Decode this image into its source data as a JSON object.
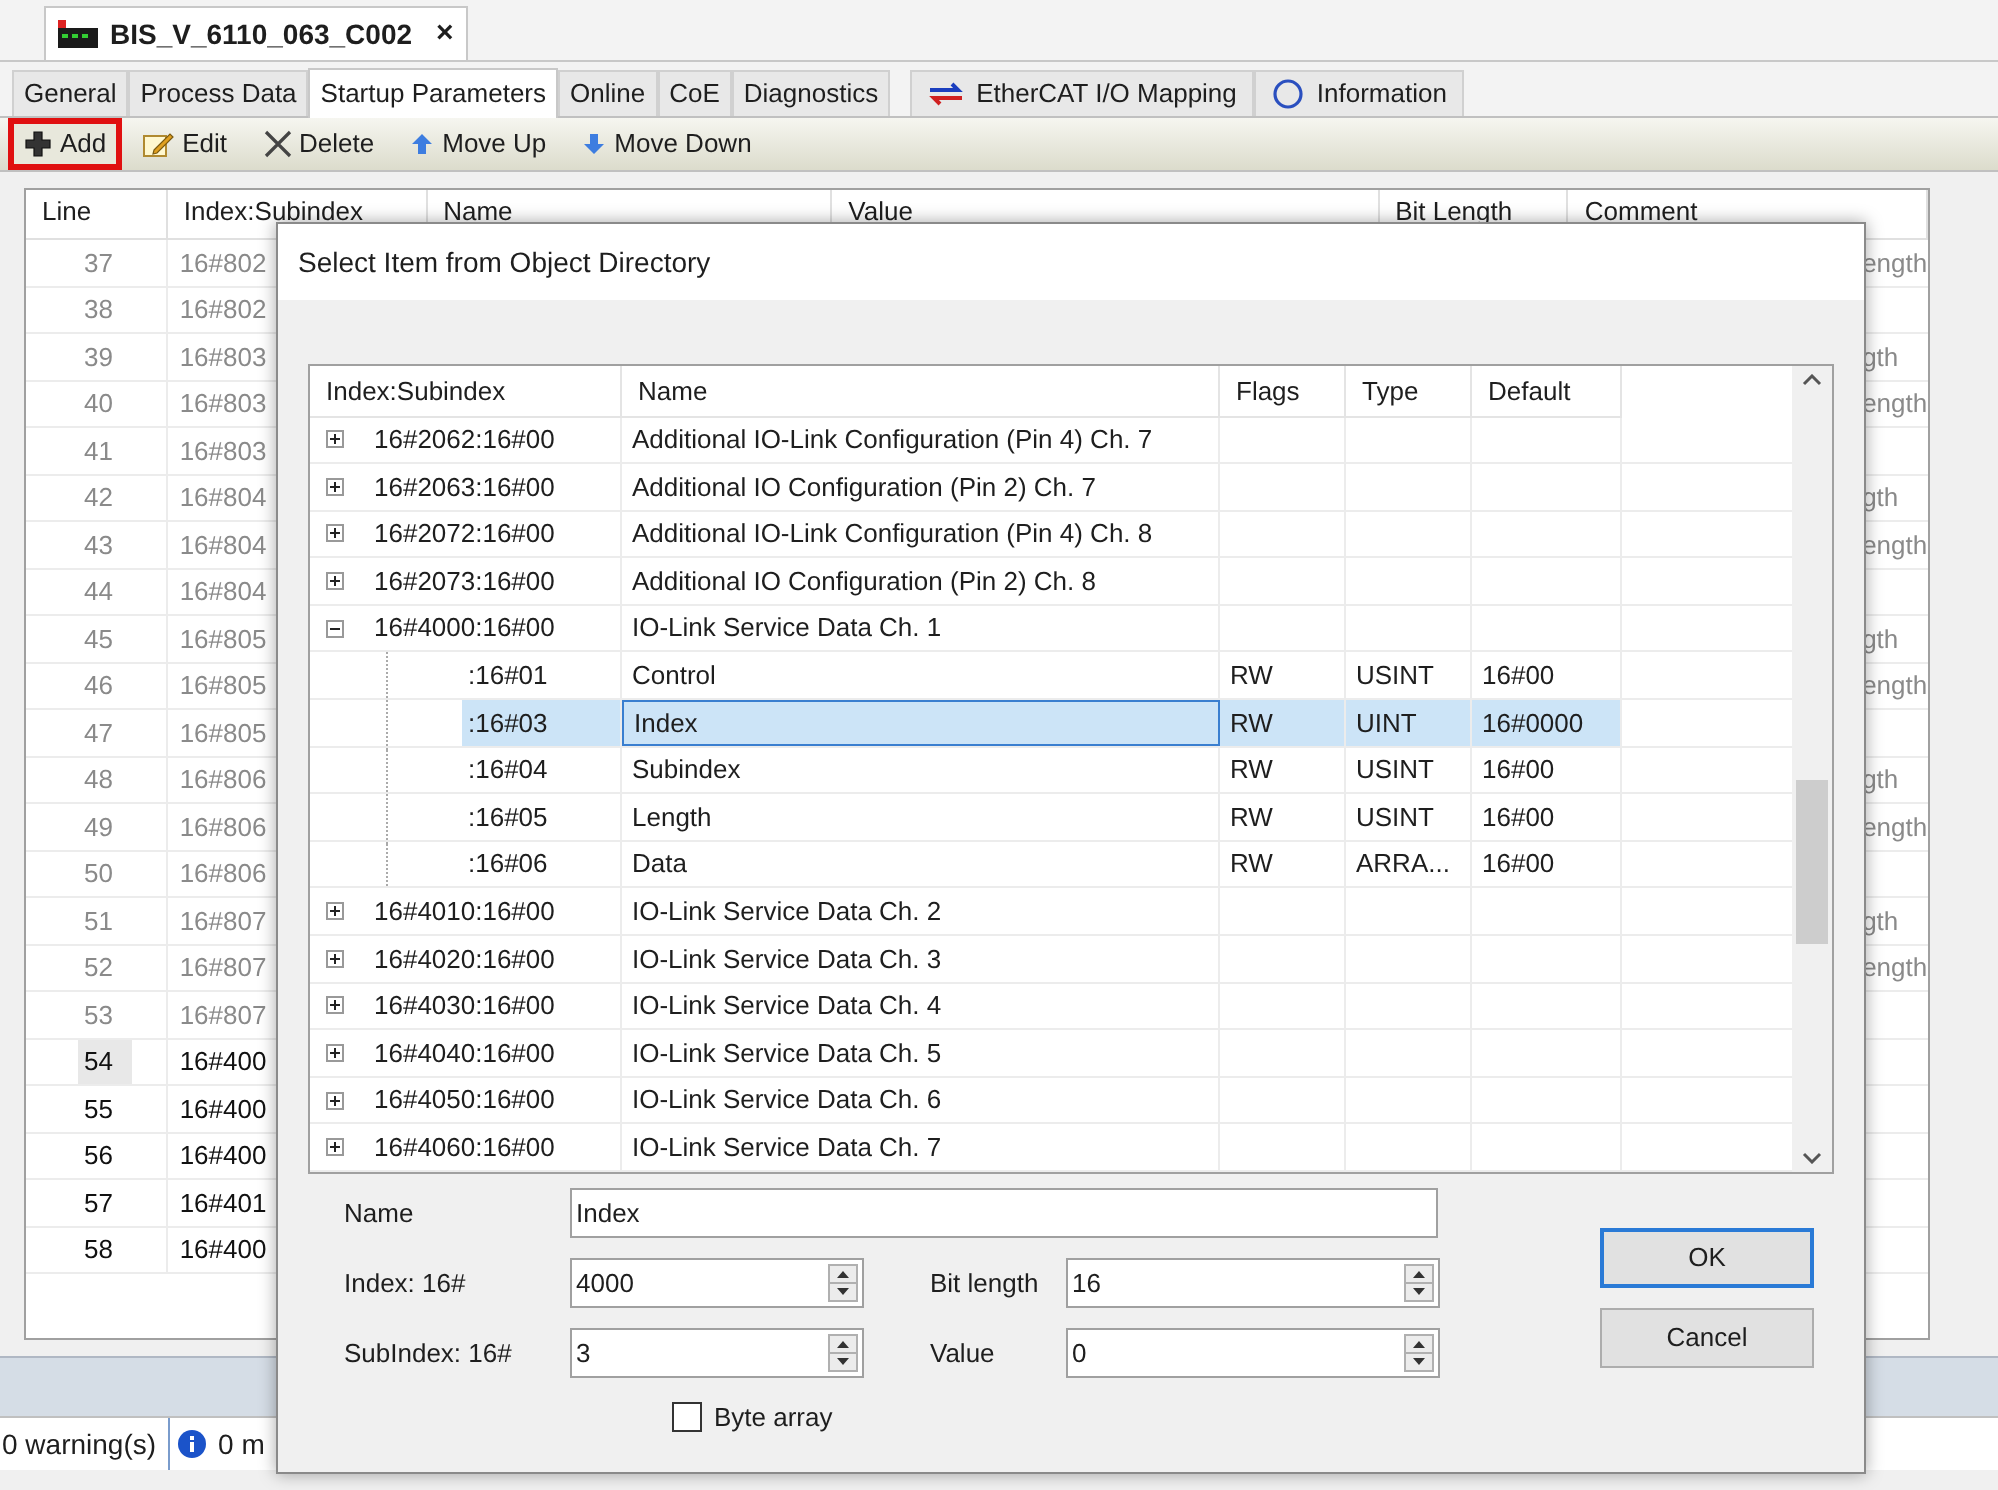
{
  "document_tab": {
    "title": "BIS_V_6110_063_C002",
    "close": "×"
  },
  "tabs": [
    {
      "label": "General",
      "selected": false
    },
    {
      "label": "Process Data",
      "selected": false
    },
    {
      "label": "Startup Parameters",
      "selected": true
    },
    {
      "label": "Online",
      "selected": false
    },
    {
      "label": "CoE",
      "selected": false
    },
    {
      "label": "Diagnostics",
      "selected": false
    },
    {
      "label": "EtherCAT I/O Mapping",
      "selected": false
    },
    {
      "label": "Information",
      "selected": false
    }
  ],
  "toolbar": [
    {
      "label": "Add",
      "highlighted": true
    },
    {
      "label": "Edit",
      "highlighted": false
    },
    {
      "label": "Delete",
      "highlighted": false
    },
    {
      "label": "Move Up",
      "highlighted": false
    },
    {
      "label": "Move Down",
      "highlighted": false
    }
  ],
  "startup_table": {
    "columns": [
      "Line",
      "Index:Subindex",
      "Name",
      "Value",
      "Bit Length",
      "Comment"
    ],
    "rows": [
      {
        "line": "37",
        "index": "16#802",
        "comment": "ength",
        "greyed": true,
        "selected": false
      },
      {
        "line": "38",
        "index": "16#802",
        "greyed": true,
        "selected": false
      },
      {
        "line": "39",
        "index": "16#803",
        "comment": "gth",
        "greyed": true,
        "selected": false
      },
      {
        "line": "40",
        "index": "16#803",
        "comment": "ength",
        "greyed": true,
        "selected": false
      },
      {
        "line": "41",
        "index": "16#803",
        "greyed": true,
        "selected": false
      },
      {
        "line": "42",
        "index": "16#804",
        "comment": "gth",
        "greyed": true,
        "selected": false
      },
      {
        "line": "43",
        "index": "16#804",
        "comment": "ength",
        "greyed": true,
        "selected": false
      },
      {
        "line": "44",
        "index": "16#804",
        "greyed": true,
        "selected": false
      },
      {
        "line": "45",
        "index": "16#805",
        "comment": "gth",
        "greyed": true,
        "selected": false
      },
      {
        "line": "46",
        "index": "16#805",
        "comment": "ength",
        "greyed": true,
        "selected": false
      },
      {
        "line": "47",
        "index": "16#805",
        "greyed": true,
        "selected": false
      },
      {
        "line": "48",
        "index": "16#806",
        "comment": "gth",
        "greyed": true,
        "selected": false
      },
      {
        "line": "49",
        "index": "16#806",
        "comment": "ength",
        "greyed": true,
        "selected": false
      },
      {
        "line": "50",
        "index": "16#806",
        "greyed": true,
        "selected": false
      },
      {
        "line": "51",
        "index": "16#807",
        "comment": "gth",
        "greyed": true,
        "selected": false
      },
      {
        "line": "52",
        "index": "16#807",
        "comment": "ength",
        "greyed": true,
        "selected": false
      },
      {
        "line": "53",
        "index": "16#807",
        "greyed": true,
        "selected": false
      },
      {
        "line": "54",
        "index": "16#400",
        "greyed": false,
        "selected": true
      },
      {
        "line": "55",
        "index": "16#400",
        "greyed": false,
        "selected": false
      },
      {
        "line": "56",
        "index": "16#400",
        "greyed": false,
        "selected": false
      },
      {
        "line": "57",
        "index": "16#401",
        "greyed": false,
        "selected": false
      },
      {
        "line": "58",
        "index": "16#400",
        "greyed": false,
        "selected": false
      }
    ]
  },
  "status_bar": {
    "warnings": "0 warning(s)",
    "messages": "0 m"
  },
  "dialog": {
    "title": "Select Item from Object Directory",
    "object_table": {
      "columns": [
        "Index:Subindex",
        "Name",
        "Flags",
        "Type",
        "Default"
      ],
      "rows": [
        {
          "index": "16#2062:16#00",
          "name": "Additional IO-Link Configuration (Pin 4) Ch. 7",
          "expanded": false,
          "selected": false
        },
        {
          "index": "16#2063:16#00",
          "name": "Additional IO Configuration (Pin 2) Ch. 7",
          "expanded": false,
          "selected": false
        },
        {
          "index": "16#2072:16#00",
          "name": "Additional IO-Link Configuration (Pin 4) Ch. 8",
          "expanded": false,
          "selected": false
        },
        {
          "index": "16#2073:16#00",
          "name": "Additional IO Configuration (Pin 2) Ch. 8",
          "expanded": false,
          "selected": false
        },
        {
          "index": "16#4000:16#00",
          "name": "IO-Link Service Data Ch. 1",
          "expanded": true,
          "selected": false,
          "children": [
            {
              "index": ":16#01",
              "name": "Control",
              "flags": "RW",
              "type": "USINT",
              "default": "16#00",
              "selected": false
            },
            {
              "index": ":16#03",
              "name": "Index",
              "flags": "RW",
              "type": "UINT",
              "default": "16#0000",
              "selected": true
            },
            {
              "index": ":16#04",
              "name": "Subindex",
              "flags": "RW",
              "type": "USINT",
              "default": "16#00",
              "selected": false
            },
            {
              "index": ":16#05",
              "name": "Length",
              "flags": "RW",
              "type": "USINT",
              "default": "16#00",
              "selected": false
            },
            {
              "index": ":16#06",
              "name": "Data",
              "flags": "RW",
              "type": "ARRA...",
              "default": "16#00",
              "selected": false
            }
          ]
        },
        {
          "index": "16#4010:16#00",
          "name": "IO-Link Service Data Ch. 2",
          "expanded": false,
          "selected": false
        },
        {
          "index": "16#4020:16#00",
          "name": "IO-Link Service Data Ch. 3",
          "expanded": false,
          "selected": false
        },
        {
          "index": "16#4030:16#00",
          "name": "IO-Link Service Data Ch. 4",
          "expanded": false,
          "selected": false
        },
        {
          "index": "16#4040:16#00",
          "name": "IO-Link Service Data Ch. 5",
          "expanded": false,
          "selected": false
        },
        {
          "index": "16#4050:16#00",
          "name": "IO-Link Service Data Ch. 6",
          "expanded": false,
          "selected": false
        },
        {
          "index": "16#4060:16#00",
          "name": "IO-Link Service Data Ch. 7",
          "expanded": false,
          "selected": false
        }
      ]
    },
    "name_label": "Name",
    "name_value": "Index",
    "index_label": "Index:  16#",
    "index_value": "4000",
    "bit_length_label": "Bit length",
    "bit_length_value": "16",
    "subindex_label": "SubIndex: 16#",
    "subindex_value": "3",
    "value_label": "Value",
    "value_value": "0",
    "byte_array": {
      "label": "Byte array",
      "checked": false
    },
    "buttons": [
      {
        "label": "OK",
        "focused": true
      },
      {
        "label": "Cancel",
        "focused": false
      }
    ]
  }
}
